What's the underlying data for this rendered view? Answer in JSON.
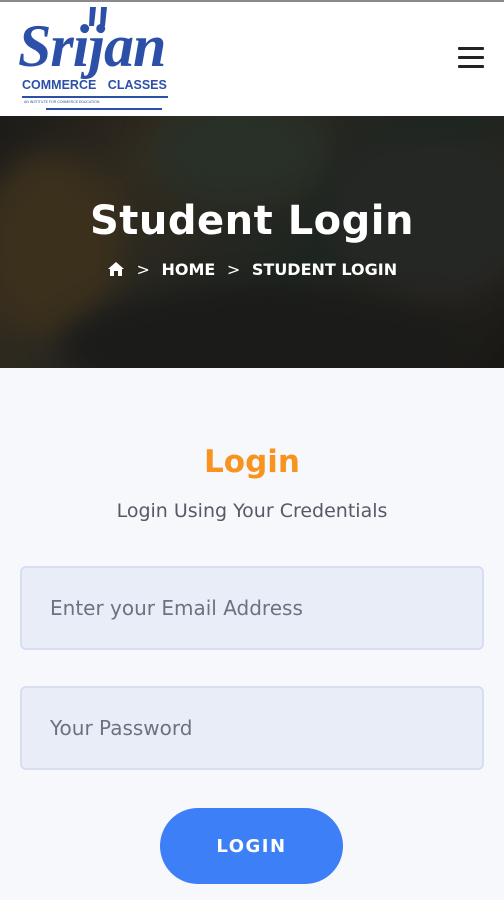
{
  "brand": {
    "name": "Srijan",
    "left_word": "COMMERCE",
    "right_word": "CLASSES",
    "tagline": "AN INSTITUTE FOR COMMERCE EDUCATION"
  },
  "menu": {
    "icon": "hamburger-menu-icon"
  },
  "hero": {
    "title": "Student Login",
    "breadcrumb": {
      "home_icon": "home-icon",
      "separator": ">",
      "items": [
        "HOME",
        "STUDENT LOGIN"
      ]
    }
  },
  "login": {
    "title": "Login",
    "subtitle": "Login Using Your Credentials",
    "email_placeholder": "Enter your Email Address",
    "password_placeholder": "Your Password",
    "button_label": "LOGIN"
  },
  "colors": {
    "brand_blue": "#2c4fa8",
    "accent_orange": "#f7931e",
    "button_blue": "#3d7ff6",
    "input_bg": "#e9edf8"
  }
}
